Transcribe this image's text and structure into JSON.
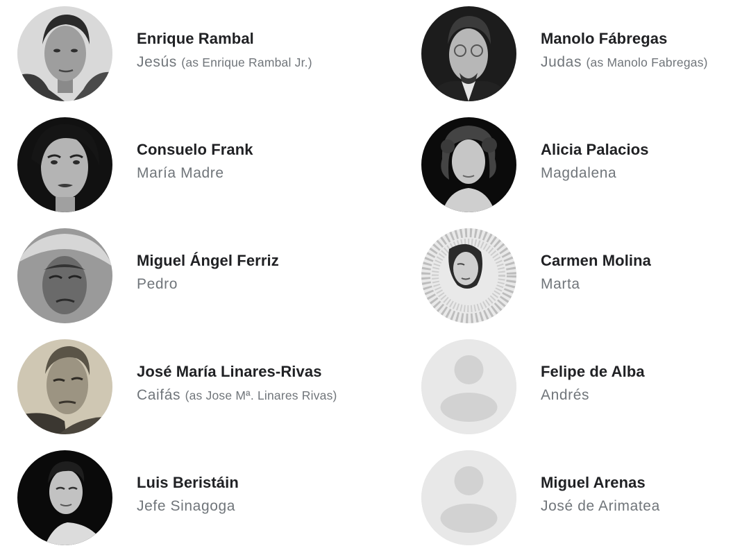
{
  "cast": [
    {
      "name": "Enrique Rambal",
      "character": "Jesús",
      "credit_note": "(as Enrique Rambal Jr.)",
      "photo": "actor-photo"
    },
    {
      "name": "Manolo Fábregas",
      "character": "Judas",
      "credit_note": "(as Manolo Fabregas)",
      "photo": "actor-photo"
    },
    {
      "name": "Consuelo Frank",
      "character": "María Madre",
      "credit_note": "",
      "photo": "actor-photo"
    },
    {
      "name": "Alicia Palacios",
      "character": "Magdalena",
      "credit_note": "",
      "photo": "actor-photo"
    },
    {
      "name": "Miguel Ángel Ferriz",
      "character": "Pedro",
      "credit_note": "",
      "photo": "actor-photo"
    },
    {
      "name": "Carmen Molina",
      "character": "Marta",
      "credit_note": "",
      "photo": "actor-photo"
    },
    {
      "name": "José María Linares-Rivas",
      "character": "Caifás",
      "credit_note": "(as Jose Mª. Linares Rivas)",
      "photo": "actor-photo"
    },
    {
      "name": "Felipe de Alba",
      "character": "Andrés",
      "credit_note": "",
      "photo": "person-placeholder-icon"
    },
    {
      "name": "Luis Beristáin",
      "character": "Jefe Sinagoga",
      "credit_note": "",
      "photo": "actor-photo"
    },
    {
      "name": "Miguel Arenas",
      "character": "José de Arimatea",
      "credit_note": "",
      "photo": "person-placeholder-icon"
    }
  ],
  "colors": {
    "name_text": "#202124",
    "role_text": "#70757a",
    "placeholder_bg": "#e8e8e8",
    "placeholder_fg": "#d2d2d2"
  }
}
